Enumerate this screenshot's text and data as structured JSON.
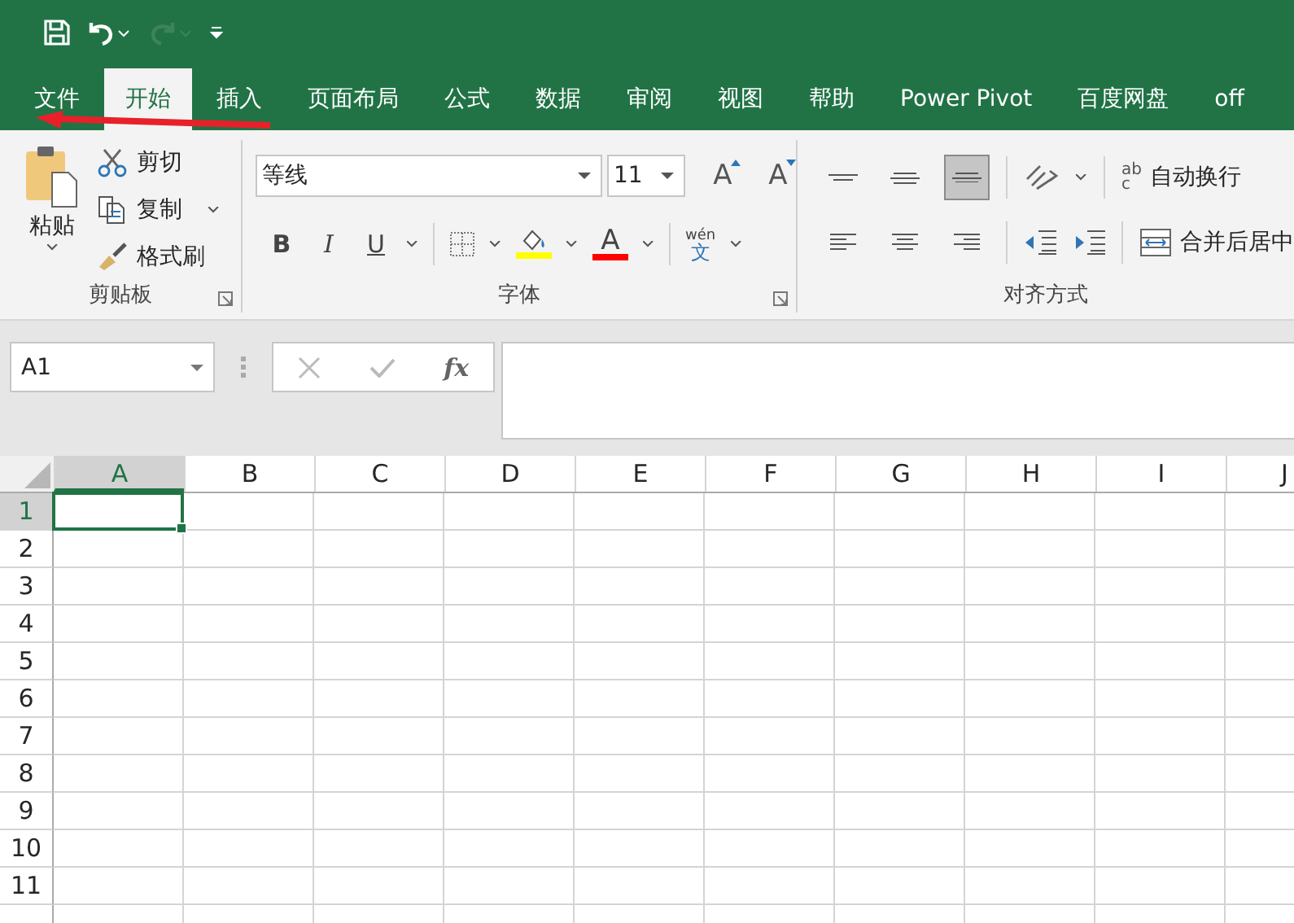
{
  "quick_access": [
    {
      "kind": "save",
      "disabled": false
    },
    {
      "kind": "undo",
      "disabled": false
    },
    {
      "kind": "redo",
      "disabled": true
    },
    {
      "kind": "customize",
      "disabled": false
    }
  ],
  "tabs": [
    {
      "label": "文件",
      "selected": false
    },
    {
      "label": "开始",
      "selected": true
    },
    {
      "label": "插入",
      "selected": false
    },
    {
      "label": "页面布局",
      "selected": false
    },
    {
      "label": "公式",
      "selected": false
    },
    {
      "label": "数据",
      "selected": false
    },
    {
      "label": "审阅",
      "selected": false
    },
    {
      "label": "视图",
      "selected": false
    },
    {
      "label": "帮助",
      "selected": false
    },
    {
      "label": "Power Pivot",
      "selected": false
    },
    {
      "label": "百度网盘",
      "selected": false
    },
    {
      "label": "off",
      "selected": false
    }
  ],
  "clipboard": {
    "paste": "粘贴",
    "group_label": "剪贴板",
    "items": [
      {
        "kind": "cut",
        "label": "剪切",
        "dropdown": false
      },
      {
        "kind": "copy",
        "label": "复制",
        "dropdown": true
      },
      {
        "kind": "painter",
        "label": "格式刷",
        "dropdown": false
      }
    ]
  },
  "font": {
    "group_label": "字体",
    "font_name": "等线",
    "font_size": "11",
    "size_buttons": [
      {
        "kind": "grow",
        "label": "A"
      },
      {
        "kind": "shrink",
        "label": "A"
      }
    ],
    "style_buttons": [
      {
        "kind": "bold",
        "label": "B",
        "dropdown": false
      },
      {
        "kind": "italic",
        "label": "I",
        "dropdown": false
      },
      {
        "kind": "underline",
        "label": "U",
        "dropdown": true
      }
    ],
    "font_color": {
      "label": "A"
    },
    "phonetic": {
      "top": "wén",
      "bottom": "文"
    }
  },
  "alignment": {
    "group_label": "对齐方式",
    "vertical": [
      {
        "kind": "top",
        "selected": false
      },
      {
        "kind": "middle",
        "selected": false
      },
      {
        "kind": "bottom",
        "selected": true
      }
    ],
    "horizontal": [
      {
        "kind": "left",
        "selected": false
      },
      {
        "kind": "center",
        "selected": false
      },
      {
        "kind": "right",
        "selected": false
      }
    ],
    "wrap_text": {
      "label": "自动换行",
      "icon_letters": [
        "ab",
        "c"
      ]
    },
    "merge": {
      "label": "合并后居中"
    }
  },
  "name_box": "A1",
  "function_label": "fx",
  "columns": [
    {
      "label": "A",
      "selected": true
    },
    {
      "label": "B",
      "selected": false
    },
    {
      "label": "C",
      "selected": false
    },
    {
      "label": "D",
      "selected": false
    },
    {
      "label": "E",
      "selected": false
    },
    {
      "label": "F",
      "selected": false
    },
    {
      "label": "G",
      "selected": false
    },
    {
      "label": "H",
      "selected": false
    },
    {
      "label": "I",
      "selected": false
    },
    {
      "label": "J",
      "selected": false
    }
  ],
  "rows": [
    {
      "label": "1",
      "selected": true
    },
    {
      "label": "2",
      "selected": false
    },
    {
      "label": "3",
      "selected": false
    },
    {
      "label": "4",
      "selected": false
    },
    {
      "label": "5",
      "selected": false
    },
    {
      "label": "6",
      "selected": false
    },
    {
      "label": "7",
      "selected": false
    },
    {
      "label": "8",
      "selected": false
    },
    {
      "label": "9",
      "selected": false
    },
    {
      "label": "10",
      "selected": false
    },
    {
      "label": "11",
      "selected": false
    }
  ]
}
